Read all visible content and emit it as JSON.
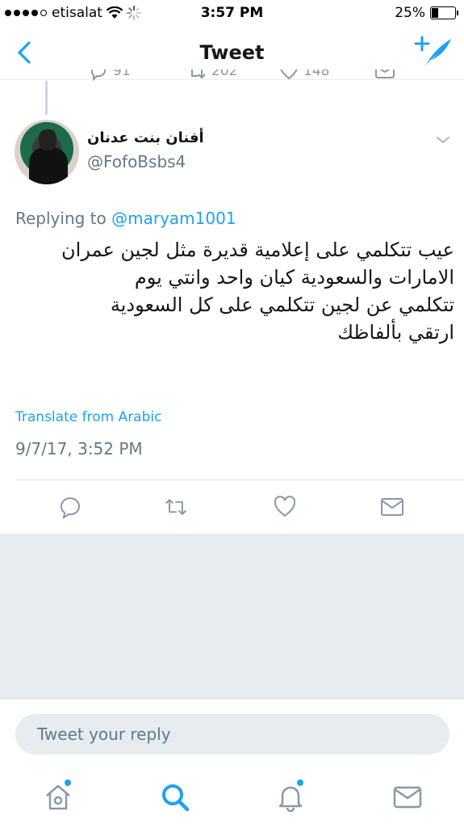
{
  "status_bar": {
    "carrier": "etisalat",
    "time": "3:57 PM",
    "battery": "25%",
    "battery_level": 0.25
  },
  "nav": {
    "title": "Tweet"
  },
  "previous_tweet": {
    "reply_count": "91",
    "retweet_count": "202",
    "like_count": "148"
  },
  "tweet": {
    "author_name": "أفنان بنت عدنان",
    "author_handle": "@FofoBsbs4",
    "replying_prefix": "Replying to",
    "replying_to": "@maryam1001",
    "text_lines": [
      "عيب تتكلمي على إعلامية قديرة مثل لجين عمران",
      "الامارات والسعودية كيان واحد وانتي يوم",
      "تتكلمي عن لجين تتكلمي على كل السعودية",
      "ارتقي بألفاظك"
    ],
    "translate_label": "Translate from Arabic",
    "timestamp": "9/7/17, 3:52 PM"
  },
  "reply": {
    "placeholder": "Tweet your reply"
  },
  "colors": {
    "accent": "#1da1f2",
    "secondary_text": "#657786",
    "icon_gray": "#8899a6"
  }
}
